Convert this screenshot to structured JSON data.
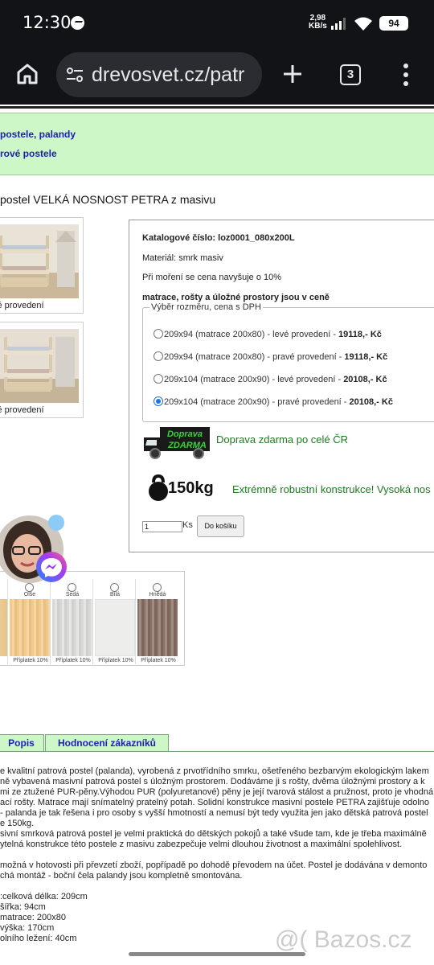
{
  "status": {
    "time": "12:30",
    "speed_value": "2,98",
    "speed_unit": "KB/s",
    "battery": "94"
  },
  "browser": {
    "url": "drevosvet.cz/patr",
    "tabs": "3"
  },
  "nav": {
    "link1": "postele, palandy",
    "link2": "rové postele"
  },
  "product": {
    "title": "postel VELKÁ NOSNOST PETRA z masivu",
    "thumb1_caption": "vé provedení",
    "thumb2_caption": "vé provedení"
  },
  "info": {
    "catalog": "Katalogové číslo: loz0001_080x200L",
    "material": "Materiál: smrk masiv",
    "moreni": "Při moření se cena navyšuje o 10%",
    "includes": "matrace, rošty a úložné prostory jsou v ceně",
    "legend": "Výběr rozměru, cena s DPH",
    "options": [
      {
        "label": "209x94 (matrace 200x80) - levé provedení - ",
        "price": "19118,- Kč"
      },
      {
        "label": "209x94 (matrace 200x80) - pravé provedení - ",
        "price": "19118,- Kč"
      },
      {
        "label": "209x104 (matrace 200x90) - levé provedení - ",
        "price": "20108,- Kč"
      },
      {
        "label": "209x104 (matrace 200x90) - pravé provedení - ",
        "price": "20108,- Kč"
      }
    ],
    "selected_option": 3,
    "truck_text1": "Doprava",
    "truck_text2": "ZDARMA",
    "shipping": "Doprava zdarma po celé ČR",
    "weight": "150kg",
    "robust": "Extrémně robustní konstrukce! Vysoká nos",
    "qty": "1",
    "ks": "Ks",
    "cart_button": "Do košíku"
  },
  "swatches": [
    {
      "name": "",
      "price": "u"
    },
    {
      "name": "Olše",
      "price": "Příplatek 10%"
    },
    {
      "name": "Šedá",
      "price": "Příplatek 10%"
    },
    {
      "name": "Bílá",
      "price": "Příplatek 10%"
    },
    {
      "name": "Hnědá",
      "price": "Příplatek 10%"
    }
  ],
  "tabs": {
    "popis": "Popis",
    "hodnoceni": "Hodnocení zákazníků"
  },
  "description": [
    "e kvalitní patrová postel (palanda), vyrobená z prvotřídního smrku, ošetřeného bezbarvým ekologickým lakem",
    "ně vybavená masivní patrová postel s úložným prostorem. Dodáváme ji s rošty, dvěma úložnými prostory a k",
    "mi ze ztužené PUR-pěny.Výhodou PUR (polyuretanové) pěny je její tvarová stálost a pružnost, proto je vhodná",
    "ací rošty. Matrace mají snímatelný pratelný potah. Solidní konstrukce masivní postele PETRA zajišťuje odolno",
    "- palanda je tak řešena i pro osoby s vyšší hmotností a nemusí být tedy využita jen jako dětská patrová postel",
    "e 150kg.",
    "sivní smrková patrová postel je velmi praktická do dětských pokojů a také všude tam, kde je třeba maximálně",
    "ytelná konstrukce této postele z masivu zabezpečuje velmi dlouhou životnost a maximální spolehlivost.",
    "",
    " možná v hotovosti při převzetí zboží, popřípadě po dohodě převodem na účet. Postel je dodávána v demonto",
    "chá montáž - boční čela palandy jsou kompletně smontována.",
    "",
    ":celková délka: 209cm",
    "šířka: 94cm",
    "matrace: 200x80",
    "výška: 170cm",
    "olního ležení: 40cm"
  ],
  "watermark": "@( Bazos.cz"
}
